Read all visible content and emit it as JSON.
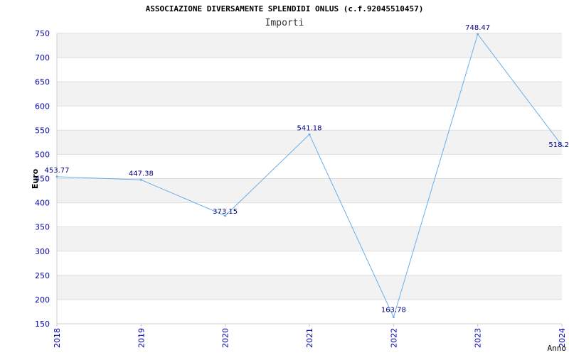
{
  "chart_data": {
    "type": "line",
    "title": "ASSOCIAZIONE DIVERSAMENTE SPLENDIDI ONLUS (c.f.92045510457)",
    "subtitle": "Importi",
    "xlabel": "Anno",
    "ylabel": "Euro",
    "categories": [
      "2018",
      "2019",
      "2020",
      "2021",
      "2022",
      "2023",
      "2024"
    ],
    "series": [
      {
        "values": [
          453.77,
          447.38,
          373.15,
          541.18,
          163.78,
          748.47,
          518.2
        ]
      }
    ],
    "data_labels": [
      "453.77",
      "447.38",
      "373.15",
      "541.18",
      "163.78",
      "748.47",
      "518.2"
    ],
    "ylim": [
      150,
      750
    ],
    "yticks": [
      150,
      200,
      250,
      300,
      350,
      400,
      450,
      500,
      550,
      600,
      650,
      700,
      750
    ],
    "grid": true,
    "colors": {
      "line": "#6aaeea",
      "band": "#f2f2f2",
      "grid": "#dddddd",
      "tick_text": "#0000aa",
      "label_text": "#000080"
    }
  }
}
